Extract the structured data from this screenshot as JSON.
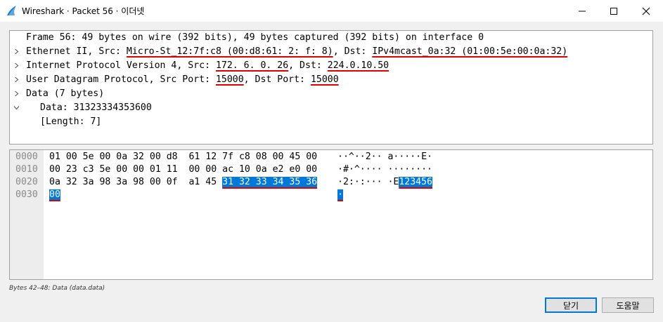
{
  "window": {
    "title": "Wireshark · Packet 56 · 이더넷"
  },
  "tree": {
    "frame": "Frame 56: 49 bytes on wire (392 bits), 49 bytes captured (392 bits) on interface 0",
    "ethernet": {
      "prefix": "Ethernet II, Src: ",
      "src": "Micro-St_12:7f:c8 (00:d8:61: 2: f: 8)",
      "mid": ", Dst: ",
      "dst": "IPv4mcast_0a:32 (01:00:5e:00:0a:32)"
    },
    "ip": {
      "prefix": "Internet Protocol Version 4, Src: ",
      "src": "172. 6. 0. 26",
      "mid": ", Dst: ",
      "dst": "224.0.10.50"
    },
    "udp": {
      "prefix": "User Datagram Protocol, Src Port: ",
      "src_port": "15000",
      "mid": ", Dst Port: ",
      "dst_port": "15000"
    },
    "data": "Data (7 bytes)",
    "data_value": "Data: 31323334353600",
    "data_length": "[Length: 7]"
  },
  "hex": {
    "offsets": [
      "0000",
      "0010",
      "0020",
      "0030"
    ],
    "rows": [
      "01 00 5e 00 0a 32 00 d8  61 12 7f c8 08 00 45 00",
      "00 23 c3 5e 00 00 01 11  00 00 ac 10 0a e2 e0 00",
      "0a 32 3a 98 3a 98 00 0f  a1 45 ",
      ""
    ],
    "row2_selected": "31 32 33 34 35 36",
    "row3_selected": "00",
    "ascii": [
      "··^··2·· a·····E·",
      "·#·^···· ········",
      "·2:·:··· ·E",
      ""
    ],
    "ascii2_selected": "123456",
    "ascii3_selected": "·"
  },
  "status": {
    "text": "Bytes 42–48: Data (data.data)"
  },
  "buttons": {
    "close": "닫기",
    "help": "도움말"
  }
}
